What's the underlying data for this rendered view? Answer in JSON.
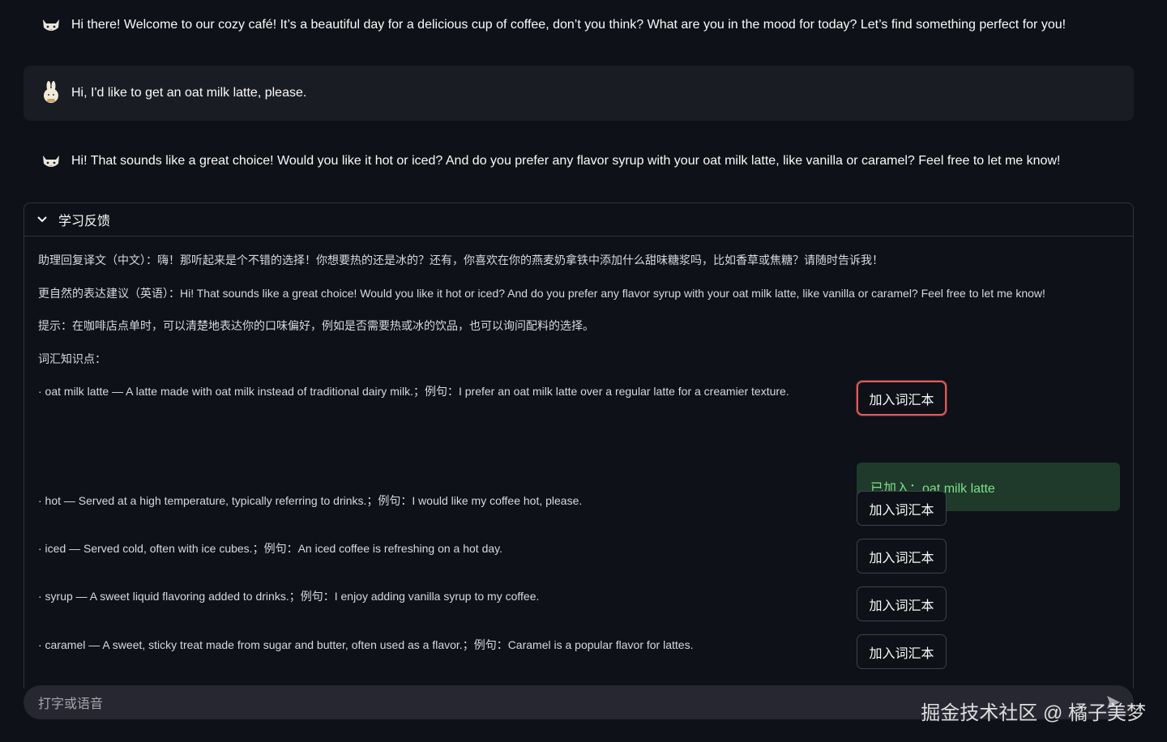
{
  "messages": [
    {
      "role": "assistant",
      "avatar_icon": "cat-face-icon",
      "text": "Hi there! Welcome to our cozy café! It’s a beautiful day for a delicious cup of coffee, don’t you think? What are you in the mood for today? Let’s find something perfect for you!"
    },
    {
      "role": "user",
      "avatar_icon": "bunny-avatar-icon",
      "text": "Hi, I'd like to get an oat milk latte, please."
    },
    {
      "role": "assistant",
      "avatar_icon": "cat-face-icon",
      "text": "Hi! That sounds like a great choice! Would you like it hot or iced? And do you prefer any flavor syrup with your oat milk latte, like vanilla or caramel? Feel free to let me know!"
    }
  ],
  "feedback": {
    "title": "学习反馈",
    "translation": "助理回复译文（中文）：嗨！那听起来是个不错的选择！你想要热的还是冰的？还有，你喜欢在你的燕麦奶拿铁中添加什么甜味糖浆吗，比如香草或焦糖？请随时告诉我！",
    "suggestion": "更自然的表达建议（英语）：Hi! That sounds like a great choice! Would you like it hot or iced? And do you prefer any flavor syrup with your oat milk latte, like vanilla or caramel? Feel free to let me know!",
    "tip": "提示：在咖啡店点单时，可以清楚地表达你的口味偏好，例如是否需要热或冰的饮品，也可以询问配料的选择。",
    "vocab_header": "词汇知识点：",
    "vocab": [
      {
        "text": "· oat milk latte — A latte made with oat milk instead of traditional dairy milk.；例句：I prefer an oat milk latte over a regular latte for a creamier texture.",
        "button": "加入词汇本"
      },
      {
        "text": "· hot — Served at a high temperature, typically referring to drinks.；例句：I would like my coffee hot, please.",
        "button": "加入词汇本"
      },
      {
        "text": "· iced — Served cold, often with ice cubes.；例句：An iced coffee is refreshing on a hot day.",
        "button": "加入词汇本"
      },
      {
        "text": "· syrup — A sweet liquid flavoring added to drinks.；例句：I enjoy adding vanilla syrup to my coffee.",
        "button": "加入词汇本"
      },
      {
        "text": "· caramel — A sweet, sticky treat made from sugar and butter, often used as a flavor.；例句：Caramel is a popular flavor for lattes.",
        "button": "加入词汇本"
      }
    ],
    "success_message": "已加入：oat milk latte"
  },
  "chat_input": {
    "placeholder": "打字或语音"
  },
  "watermark": "掘金技术社区 @ 橘子美梦",
  "colors": {
    "success_bg": "#1f3a2a",
    "success_text": "#7ee08a",
    "focus_border": "#e05b5b"
  }
}
